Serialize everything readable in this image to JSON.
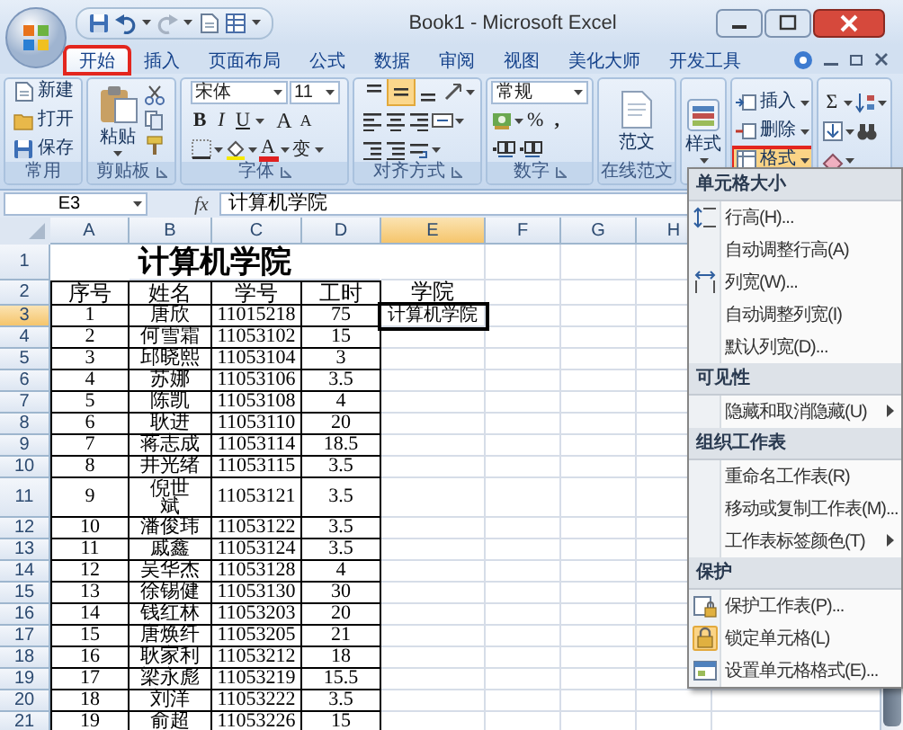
{
  "window": {
    "title": "Book1 - Microsoft Excel"
  },
  "tabs": [
    {
      "label": "开始",
      "selected": true,
      "marked": true
    },
    {
      "label": "插入",
      "selected": false,
      "marked": false
    },
    {
      "label": "页面布局",
      "selected": false,
      "marked": false
    },
    {
      "label": "公式",
      "selected": false,
      "marked": false
    },
    {
      "label": "数据",
      "selected": false,
      "marked": false
    },
    {
      "label": "审阅",
      "selected": false,
      "marked": false
    },
    {
      "label": "视图",
      "selected": false,
      "marked": false
    },
    {
      "label": "美化大师",
      "selected": false,
      "marked": false
    },
    {
      "label": "开发工具",
      "selected": false,
      "marked": false
    }
  ],
  "ribbon": {
    "groups": [
      {
        "kind": "common",
        "label": "常用",
        "items": [
          "新建",
          "打开",
          "保存"
        ]
      },
      {
        "kind": "clipboard",
        "label": "剪贴板",
        "paste": "粘贴"
      },
      {
        "kind": "font",
        "label": "字体",
        "font": "宋体",
        "size": "11",
        "styles": [
          "B",
          "I",
          "U"
        ],
        "grow": "A",
        "shrink": "A",
        "color_letter": "A",
        "phonetic": "变"
      },
      {
        "kind": "alignment",
        "label": "对齐方式",
        "vertical_align": [
          {
            "selected": false
          },
          {
            "selected": true
          },
          {
            "selected": false
          }
        ]
      },
      {
        "kind": "number",
        "label": "数字",
        "format": "常规",
        "percent": "%",
        "comma": ","
      },
      {
        "kind": "large",
        "label": "在线范文",
        "button": "范文"
      },
      {
        "kind": "styles",
        "button": "样式"
      },
      {
        "kind": "cells",
        "items": [
          {
            "label": "插入",
            "marked": false
          },
          {
            "label": "删除",
            "marked": false
          },
          {
            "label": "格式",
            "marked": true
          }
        ]
      },
      {
        "kind": "editing",
        "sum": "Σ"
      }
    ]
  },
  "formula_bar": {
    "name_box": "E3",
    "fx": "fx",
    "formula": "计算机学院"
  },
  "sheet": {
    "columns": [
      {
        "label": "A",
        "selected": false
      },
      {
        "label": "B",
        "selected": false
      },
      {
        "label": "C",
        "selected": false
      },
      {
        "label": "D",
        "selected": false
      },
      {
        "label": "E",
        "selected": true
      },
      {
        "label": "F",
        "selected": false
      },
      {
        "label": "G",
        "selected": false
      },
      {
        "label": "H",
        "selected": false
      }
    ],
    "rows": [
      {
        "number": "1",
        "kind": "title",
        "selected": false,
        "wrapped": false,
        "cells": [
          "",
          "计算机学院"
        ]
      },
      {
        "number": "2",
        "kind": "header",
        "selected": false,
        "wrapped": false,
        "cells": [
          "序号",
          "姓名",
          "学号",
          "工时",
          "学院"
        ]
      },
      {
        "number": "3",
        "kind": "data",
        "selected": true,
        "wrapped": false,
        "cells": [
          "1",
          "唐欣",
          "11015218",
          "75",
          "计算机学院"
        ]
      },
      {
        "number": "4",
        "kind": "data",
        "selected": false,
        "wrapped": false,
        "cells": [
          "2",
          "何雪霜",
          "11053102",
          "15"
        ]
      },
      {
        "number": "5",
        "kind": "data",
        "selected": false,
        "wrapped": false,
        "cells": [
          "3",
          "邱晓熙",
          "11053104",
          "3"
        ]
      },
      {
        "number": "6",
        "kind": "data",
        "selected": false,
        "wrapped": false,
        "cells": [
          "4",
          "苏娜",
          "11053106",
          "3.5"
        ]
      },
      {
        "number": "7",
        "kind": "data",
        "selected": false,
        "wrapped": false,
        "cells": [
          "5",
          "陈凯",
          "11053108",
          "4"
        ]
      },
      {
        "number": "8",
        "kind": "data",
        "selected": false,
        "wrapped": false,
        "cells": [
          "6",
          "耿进",
          "11053110",
          "20"
        ]
      },
      {
        "number": "9",
        "kind": "data",
        "selected": false,
        "wrapped": false,
        "cells": [
          "7",
          "蒋志成",
          "11053114",
          "18.5"
        ]
      },
      {
        "number": "10",
        "kind": "data",
        "selected": false,
        "wrapped": false,
        "cells": [
          "8",
          "井光绪",
          "11053115",
          "3.5"
        ]
      },
      {
        "number": "11",
        "kind": "data",
        "selected": false,
        "wrapped": true,
        "cells": [
          "9",
          "倪世斌",
          "11053121",
          "3.5"
        ]
      },
      {
        "number": "12",
        "kind": "data",
        "selected": false,
        "wrapped": false,
        "cells": [
          "10",
          "潘俊玮",
          "11053122",
          "3.5"
        ]
      },
      {
        "number": "13",
        "kind": "data",
        "selected": false,
        "wrapped": false,
        "cells": [
          "11",
          "戚鑫",
          "11053124",
          "3.5"
        ]
      },
      {
        "number": "14",
        "kind": "data",
        "selected": false,
        "wrapped": false,
        "cells": [
          "12",
          "吴华杰",
          "11053128",
          "4"
        ]
      },
      {
        "number": "15",
        "kind": "data",
        "selected": false,
        "wrapped": false,
        "cells": [
          "13",
          "徐锡健",
          "11053130",
          "30"
        ]
      },
      {
        "number": "16",
        "kind": "data",
        "selected": false,
        "wrapped": false,
        "cells": [
          "14",
          "钱红林",
          "11053203",
          "20"
        ]
      },
      {
        "number": "17",
        "kind": "data",
        "selected": false,
        "wrapped": false,
        "cells": [
          "15",
          "唐焕纤",
          "11053205",
          "21"
        ]
      },
      {
        "number": "18",
        "kind": "data",
        "selected": false,
        "wrapped": false,
        "cells": [
          "16",
          "耿家利",
          "11053212",
          "18"
        ]
      },
      {
        "number": "19",
        "kind": "data",
        "selected": false,
        "wrapped": false,
        "cells": [
          "17",
          "梁永彪",
          "11053219",
          "15.5"
        ]
      },
      {
        "number": "20",
        "kind": "data",
        "selected": false,
        "wrapped": false,
        "cells": [
          "18",
          "刘洋",
          "11053222",
          "3.5"
        ]
      },
      {
        "number": "21",
        "kind": "data",
        "selected": false,
        "wrapped": false,
        "cells": [
          "19",
          "俞超",
          "11053226",
          "15"
        ]
      }
    ]
  },
  "menu": {
    "sections": [
      {
        "title": "单元格大小",
        "items": [
          {
            "label": "行高(H)...",
            "kind": "rowheight",
            "submenu": false,
            "checked": false
          },
          {
            "label": "自动调整行高(A)",
            "kind": "plain",
            "submenu": false,
            "checked": false
          },
          {
            "label": "列宽(W)...",
            "kind": "colwidth",
            "submenu": false,
            "checked": false
          },
          {
            "label": "自动调整列宽(I)",
            "kind": "plain",
            "submenu": false,
            "checked": false
          },
          {
            "label": "默认列宽(D)...",
            "kind": "plain",
            "submenu": false,
            "checked": false
          }
        ]
      },
      {
        "title": "可见性",
        "items": [
          {
            "label": "隐藏和取消隐藏(U)",
            "kind": "plain",
            "submenu": true,
            "checked": false
          }
        ]
      },
      {
        "title": "组织工作表",
        "items": [
          {
            "label": "重命名工作表(R)",
            "kind": "plain",
            "submenu": false,
            "checked": false
          },
          {
            "label": "移动或复制工作表(M)...",
            "kind": "plain",
            "submenu": false,
            "checked": false
          },
          {
            "label": "工作表标签颜色(T)",
            "kind": "plain",
            "submenu": true,
            "checked": false
          }
        ]
      },
      {
        "title": "保护",
        "items": [
          {
            "label": "保护工作表(P)...",
            "kind": "protect",
            "submenu": false,
            "checked": false
          },
          {
            "label": "锁定单元格(L)",
            "kind": "lock",
            "submenu": false,
            "checked": true
          },
          {
            "label": "设置单元格格式(E)...",
            "kind": "format",
            "submenu": false,
            "checked": false
          }
        ]
      }
    ]
  }
}
